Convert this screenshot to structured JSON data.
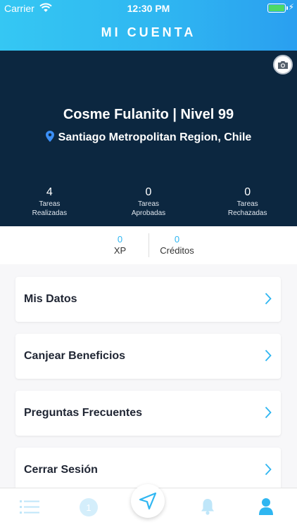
{
  "status_bar": {
    "carrier": "Carrier",
    "time": "12:30 PM"
  },
  "header": {
    "title": "MI CUENTA"
  },
  "profile": {
    "name": "Cosme Fulanito | Nivel 99",
    "location": "Santiago Metropolitan Region, Chile",
    "stats": [
      {
        "value": "4",
        "line1": "Tareas",
        "line2": "Realizadas"
      },
      {
        "value": "0",
        "line1": "Tareas",
        "line2": "Aprobadas"
      },
      {
        "value": "0",
        "line1": "Tareas",
        "line2": "Rechazadas"
      }
    ]
  },
  "points": {
    "xp": {
      "value": "0",
      "label": "XP"
    },
    "credits": {
      "value": "0",
      "label": "Créditos"
    }
  },
  "menu": {
    "items": [
      {
        "label": "Mis Datos"
      },
      {
        "label": "Canjear Beneficios"
      },
      {
        "label": "Preguntas Frecuentes"
      },
      {
        "label": "Cerrar Sesión"
      }
    ]
  },
  "tabbar": {
    "badge": "1",
    "icons": [
      "list-icon",
      "notice-icon",
      "location-arrow-icon",
      "bell-icon",
      "user-icon"
    ]
  },
  "colors": {
    "accent": "#2fb6f1",
    "header_bg": "#0c2740",
    "location_pin": "#3b8ff6",
    "battery": "#4cd964"
  }
}
